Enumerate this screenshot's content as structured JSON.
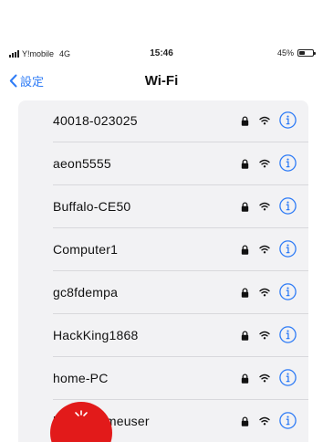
{
  "status": {
    "carrier": "Y!mobile",
    "network": "4G",
    "time": "15:46",
    "battery_text": "45%",
    "battery_level": 0.45
  },
  "nav": {
    "back_label": "設定",
    "title": "Wi-Fi"
  },
  "networks": [
    {
      "ssid": "40018-023025",
      "secured": true
    },
    {
      "ssid": "aeon5555",
      "secured": true
    },
    {
      "ssid": "Buffalo-CE50",
      "secured": true
    },
    {
      "ssid": "Computer1",
      "secured": true
    },
    {
      "ssid": "gc8fdempa",
      "secured": true
    },
    {
      "ssid": "HackKing1868",
      "secured": true
    },
    {
      "ssid": "home-PC",
      "secured": true
    },
    {
      "ssid": "logitecgameuser",
      "secured": true
    }
  ],
  "colors": {
    "accent": "#2f7cf6",
    "list_background": "#f2f2f4",
    "fab": "#e21a1a"
  },
  "icons": {
    "lock": "lock-icon",
    "wifi": "wifi-icon",
    "info": "info-icon",
    "back": "chevron-left-icon"
  }
}
